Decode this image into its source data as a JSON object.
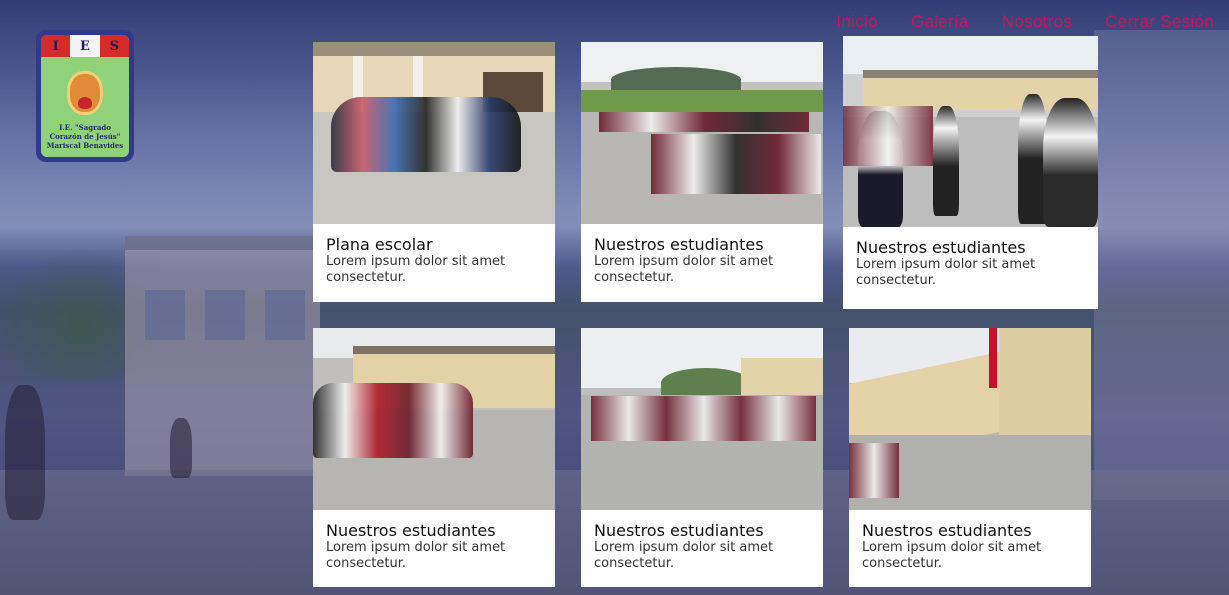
{
  "nav": {
    "items": [
      {
        "label": "Inicio"
      },
      {
        "label": "Galería"
      },
      {
        "label": "Nosotros"
      },
      {
        "label": "Cerrar Sesión"
      }
    ],
    "color": "#c2185b"
  },
  "logo": {
    "letters": [
      "I",
      "E",
      "S"
    ],
    "name": "I.E. \"Sagrado Corazón de Jesús\" Mariscal Benavides"
  },
  "cards": [
    {
      "title": "Plana escolar",
      "text": "Lorem ipsum dolor sit amet consectetur."
    },
    {
      "title": "Nuestros estudiantes",
      "text": "Lorem ipsum dolor sit amet consectetur."
    },
    {
      "title": "Nuestros estudiantes",
      "text": "Lorem ipsum dolor sit amet consectetur."
    },
    {
      "title": "Nuestros estudiantes",
      "text": "Lorem ipsum dolor sit amet consectetur."
    },
    {
      "title": "Nuestros estudiantes",
      "text": "Lorem ipsum dolor sit amet consectetur."
    },
    {
      "title": "Nuestros estudiantes",
      "text": "Lorem ipsum dolor sit amet consectetur."
    }
  ]
}
